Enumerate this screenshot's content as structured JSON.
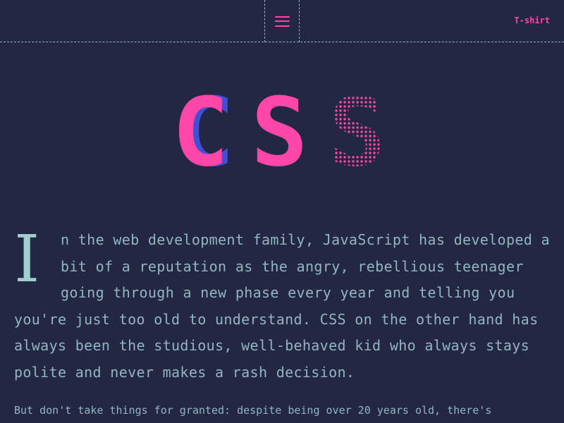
{
  "header": {
    "menu_icon": "hamburger-menu-icon",
    "tshirt_label": "T-shirt"
  },
  "hero": {
    "logo_text": "CSS",
    "letters": [
      "C",
      "S",
      "S"
    ]
  },
  "article": {
    "dropcap": "I",
    "intro_rest": "n the web development family, JavaScript has developed a bit of a reputation as the angry, rebellious teenager going through a new phase every year and telling you you're just too old to understand. CSS on the other hand has always been the studious, well-behaved kid who always stays polite and never makes a rash decision.",
    "second_paragraph": "But don't take things for granted: despite being over 20 years old, there's"
  },
  "colors": {
    "background": "#232743",
    "accent_pink": "#ff47a8",
    "accent_blue": "#3f4fd8",
    "text_teal": "#93b5c0",
    "dropcap_teal": "#9fd0cf"
  }
}
